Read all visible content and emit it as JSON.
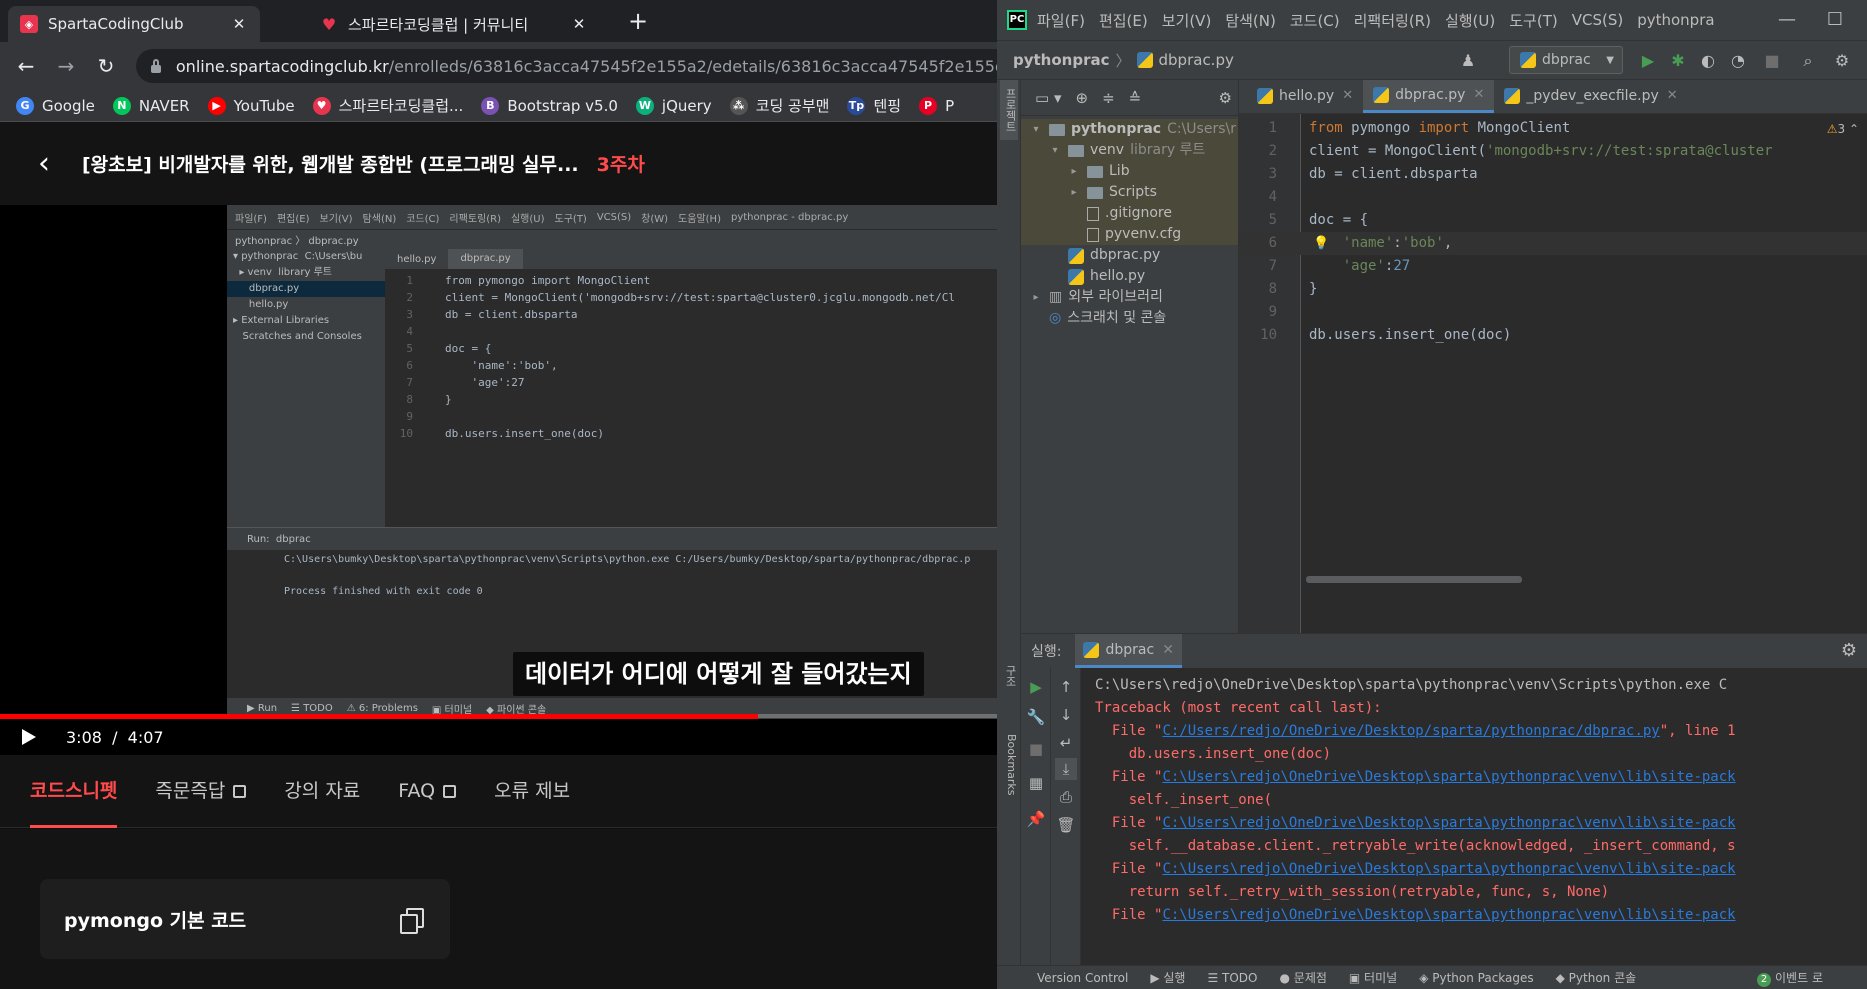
{
  "browser": {
    "tabs": [
      {
        "title": "SpartaCodingClub",
        "color": "#e8344e"
      },
      {
        "title": "스파르타코딩클럽 | 커뮤니티",
        "color": "#e8344e"
      }
    ],
    "url_main": "online.spartacodingclub.kr",
    "url_rest": "/enrolleds/63816c3acca47545f2e155a2/edetails/63816c3acca47545f2e155d3?",
    "bookmarks": [
      {
        "label": "Google",
        "icon": "G",
        "color": "#4285f4"
      },
      {
        "label": "NAVER",
        "icon": "N",
        "color": "#03c75a"
      },
      {
        "label": "YouTube",
        "icon": "▶",
        "color": "#ff0000"
      },
      {
        "label": "스파르타코딩클럽...",
        "icon": "♥",
        "color": "#e8344e"
      },
      {
        "label": "Bootstrap v5.0",
        "icon": "B",
        "color": "#7952b3"
      },
      {
        "label": "jQuery",
        "icon": "W",
        "color": "#0bb07a"
      },
      {
        "label": "코딩 공부맨",
        "icon": "⁂",
        "color": "#555555"
      },
      {
        "label": "텐핑",
        "icon": "Tp",
        "color": "#2a4a9a"
      },
      {
        "label": "P",
        "icon": "P",
        "color": "#e60023"
      }
    ]
  },
  "course": {
    "title": "[왕초보] 비개발자를 위한, 웹개발 종합반 (프로그래밍 실무...",
    "week": "3주차"
  },
  "video": {
    "current_time": "3:08",
    "separator": "/",
    "duration": "4:07",
    "progress_fraction": 0.76,
    "subtitle": "데이터가 어디에 어떻게 잘 들어갔는지",
    "mini_ide": {
      "menu": [
        "파일(F)",
        "편집(E)",
        "보기(V)",
        "탐색(N)",
        "코드(C)",
        "리팩토링(R)",
        "실행(U)",
        "도구(T)",
        "VCS(S)",
        "창(W)",
        "도움말(H)",
        "pythonprac - dbprac.py"
      ],
      "crumb": "pythonprac  〉 dbprac.py",
      "tree": [
        "▾ pythonprac  C:\\Users\\bu",
        "  ▸ venv  library 루트",
        "     dbprac.py",
        "     hello.py",
        "▸ External Libraries",
        "   Scratches and Consoles"
      ],
      "tabs": [
        "hello.py",
        "dbprac.py"
      ],
      "code": [
        "from pymongo import MongoClient",
        "client = MongoClient('mongodb+srv://test:sparta@cluster0.jcglu.mongodb.net/Cl",
        "db = client.dbsparta",
        "",
        "doc = {",
        "    'name':'bob',",
        "    'age':27",
        "}",
        "",
        "db.users.insert_one(doc)"
      ],
      "run_label": "Run:",
      "run_tab": "dbprac",
      "run_cmd": "C:\\Users\\bumky\\Desktop\\sparta\\pythonprac\\venv\\Scripts\\python.exe C:/Users/bumky/Desktop/sparta/pythonprac/dbprac.p",
      "run_exit": "Process finished with exit code 0",
      "bottom": [
        "▶ Run",
        "☰ TODO",
        "⚠ 6: Problems",
        "▣ 터미널",
        "◆ 파이썬 콘솔"
      ]
    }
  },
  "content_tabs": [
    {
      "label": "코드스니펫",
      "active": true,
      "external": false
    },
    {
      "label": "즉문즉답",
      "active": false,
      "external": true
    },
    {
      "label": "강의 자료",
      "active": false,
      "external": false
    },
    {
      "label": "FAQ",
      "active": false,
      "external": true
    },
    {
      "label": "오류 제보",
      "active": false,
      "external": false
    }
  ],
  "snippet": {
    "title": "pymongo 기본 코드"
  },
  "ide": {
    "menu": [
      "파일(F)",
      "편집(E)",
      "보기(V)",
      "탐색(N)",
      "코드(C)",
      "리팩터링(R)",
      "실행(U)",
      "도구(T)",
      "VCS(S)",
      "pythonpra"
    ],
    "crumb_project": "pythonprac",
    "crumb_file": "dbprac.py",
    "run_config": "dbprac",
    "project_tree": [
      {
        "depth": 0,
        "chev": "▾",
        "icon": "folder",
        "name": "pythonprac",
        "note": "C:\\Users\\r",
        "bold": true,
        "hl": true
      },
      {
        "depth": 1,
        "chev": "▾",
        "icon": "folder",
        "name": "venv",
        "note": "library 루트",
        "bold": false,
        "hl": true
      },
      {
        "depth": 2,
        "chev": "▸",
        "icon": "folder",
        "name": "Lib",
        "note": "",
        "bold": false,
        "hl": true
      },
      {
        "depth": 2,
        "chev": "▸",
        "icon": "folder",
        "name": "Scripts",
        "note": "",
        "bold": false,
        "hl": true
      },
      {
        "depth": 2,
        "chev": "",
        "icon": "txt",
        "name": ".gitignore",
        "note": "",
        "bold": false,
        "hl": true
      },
      {
        "depth": 2,
        "chev": "",
        "icon": "txt",
        "name": "pyvenv.cfg",
        "note": "",
        "bold": false,
        "hl": true
      },
      {
        "depth": 1,
        "chev": "",
        "icon": "py",
        "name": "dbprac.py",
        "note": "",
        "bold": false,
        "hl": false
      },
      {
        "depth": 1,
        "chev": "",
        "icon": "py",
        "name": "hello.py",
        "note": "",
        "bold": false,
        "hl": false
      },
      {
        "depth": 0,
        "chev": "▸",
        "icon": "lib",
        "name": "외부 라이브러리",
        "note": "",
        "bold": false,
        "hl": false
      },
      {
        "depth": 0,
        "chev": "",
        "icon": "scratch",
        "name": "스크래치 및 콘솔",
        "note": "",
        "bold": false,
        "hl": false
      }
    ],
    "editor_tabs": [
      {
        "name": "hello.py",
        "active": false
      },
      {
        "name": "dbprac.py",
        "active": true
      },
      {
        "name": "_pydev_execfile.py",
        "active": false
      }
    ],
    "warnings": "3",
    "code_lines": [
      "from pymongo import MongoClient",
      "client = MongoClient('mongodb+srv://test:sprata@cluster",
      "db = client.dbsparta",
      "",
      "doc = {",
      "    'name':'bob',",
      "    'age':27",
      "}",
      "",
      "db.users.insert_one(doc)"
    ],
    "run_label": "실행:",
    "run_tab": "dbprac",
    "output": [
      {
        "type": "plain",
        "pre": "C:\\Users\\redjo\\OneDrive\\Desktop\\sparta\\pythonprac\\venv\\Scripts\\python.exe C",
        "link": "",
        "post": ""
      },
      {
        "type": "err",
        "pre": "Traceback (most recent call last):",
        "link": "",
        "post": ""
      },
      {
        "type": "err",
        "pre": "  File \"",
        "link": "C:/Users/redjo/OneDrive/Desktop/sparta/pythonprac/dbprac.py",
        "post": "\", line 1"
      },
      {
        "type": "err",
        "pre": "    db.users.insert_one(doc)",
        "link": "",
        "post": ""
      },
      {
        "type": "err",
        "pre": "  File \"",
        "link": "C:\\Users\\redjo\\OneDrive\\Desktop\\sparta\\pythonprac\\venv\\lib\\site-pack",
        "post": ""
      },
      {
        "type": "err",
        "pre": "    self._insert_one(",
        "link": "",
        "post": ""
      },
      {
        "type": "err",
        "pre": "  File \"",
        "link": "C:\\Users\\redjo\\OneDrive\\Desktop\\sparta\\pythonprac\\venv\\lib\\site-pack",
        "post": ""
      },
      {
        "type": "err",
        "pre": "    self.__database.client._retryable_write(acknowledged, _insert_command, s",
        "link": "",
        "post": ""
      },
      {
        "type": "err",
        "pre": "  File \"",
        "link": "C:\\Users\\redjo\\OneDrive\\Desktop\\sparta\\pythonprac\\venv\\lib\\site-pack",
        "post": ""
      },
      {
        "type": "err",
        "pre": "    return self._retry_with_session(retryable, func, s, None)",
        "link": "",
        "post": ""
      },
      {
        "type": "err",
        "pre": "  File \"",
        "link": "C:\\Users\\redjo\\OneDrive\\Desktop\\sparta\\pythonprac\\venv\\lib\\site-pack",
        "post": ""
      }
    ],
    "left_strip": [
      "프로젝트",
      "구조",
      "Bookmarks"
    ],
    "status": [
      "Version Control",
      "▶ 실행",
      "☰ TODO",
      "● 문제점",
      "▣ 터미널",
      "◈ Python Packages",
      "◆ Python 콘솔"
    ],
    "status_event_count": "2",
    "status_event_label": "이벤트 로"
  }
}
